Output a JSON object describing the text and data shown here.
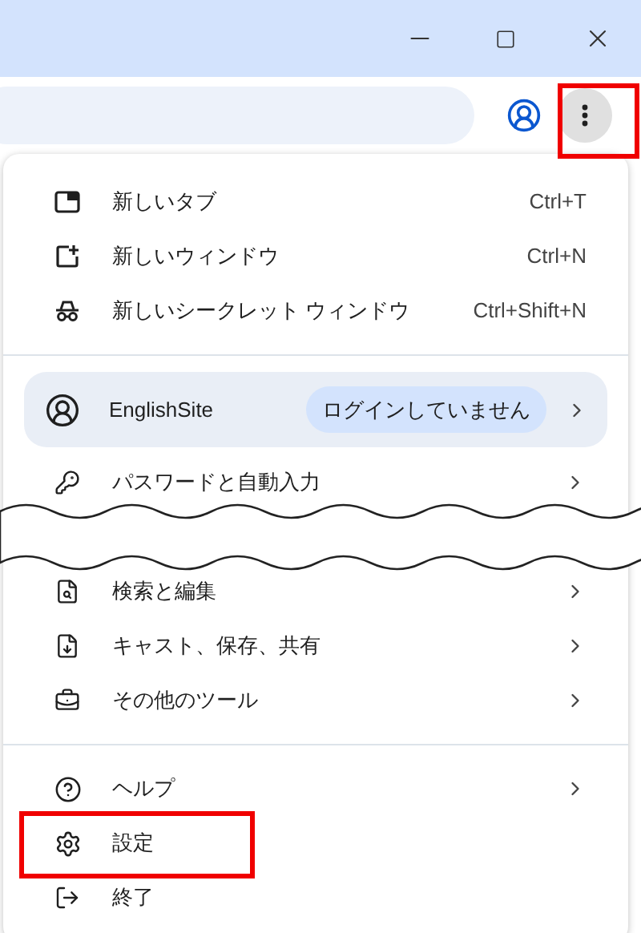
{
  "toolbar": {
    "menu_button": {
      "highlighted": true
    }
  },
  "menu": {
    "sections": [
      {
        "items": [
          {
            "kind": "item",
            "label": "新しいタブ",
            "shortcut": "Ctrl+T",
            "submenu": false,
            "highlighted": false
          },
          {
            "kind": "item",
            "label": "新しいウィンドウ",
            "shortcut": "Ctrl+N",
            "submenu": false,
            "highlighted": false
          },
          {
            "kind": "item",
            "label": "新しいシークレット ウィンドウ",
            "shortcut": "Ctrl+Shift+N",
            "submenu": false,
            "highlighted": false
          }
        ]
      },
      {
        "items": [
          {
            "kind": "profile",
            "label": "EnglishSite",
            "status": "ログインしていません",
            "submenu": true,
            "highlighted": false
          },
          {
            "kind": "item",
            "label": "パスワードと自動入力",
            "submenu": true,
            "highlighted": false
          },
          {
            "kind": "break"
          },
          {
            "kind": "item",
            "label": "検索と編集",
            "submenu": true,
            "highlighted": false
          },
          {
            "kind": "item",
            "label": "キャスト、保存、共有",
            "submenu": true,
            "highlighted": false
          },
          {
            "kind": "item",
            "label": "その他のツール",
            "submenu": true,
            "highlighted": false
          }
        ]
      },
      {
        "items": [
          {
            "kind": "item",
            "label": "ヘルプ",
            "submenu": true,
            "highlighted": false
          },
          {
            "kind": "item",
            "label": "設定",
            "submenu": false,
            "highlighted": true
          },
          {
            "kind": "item",
            "label": "終了",
            "submenu": false,
            "highlighted": false
          }
        ]
      }
    ]
  }
}
